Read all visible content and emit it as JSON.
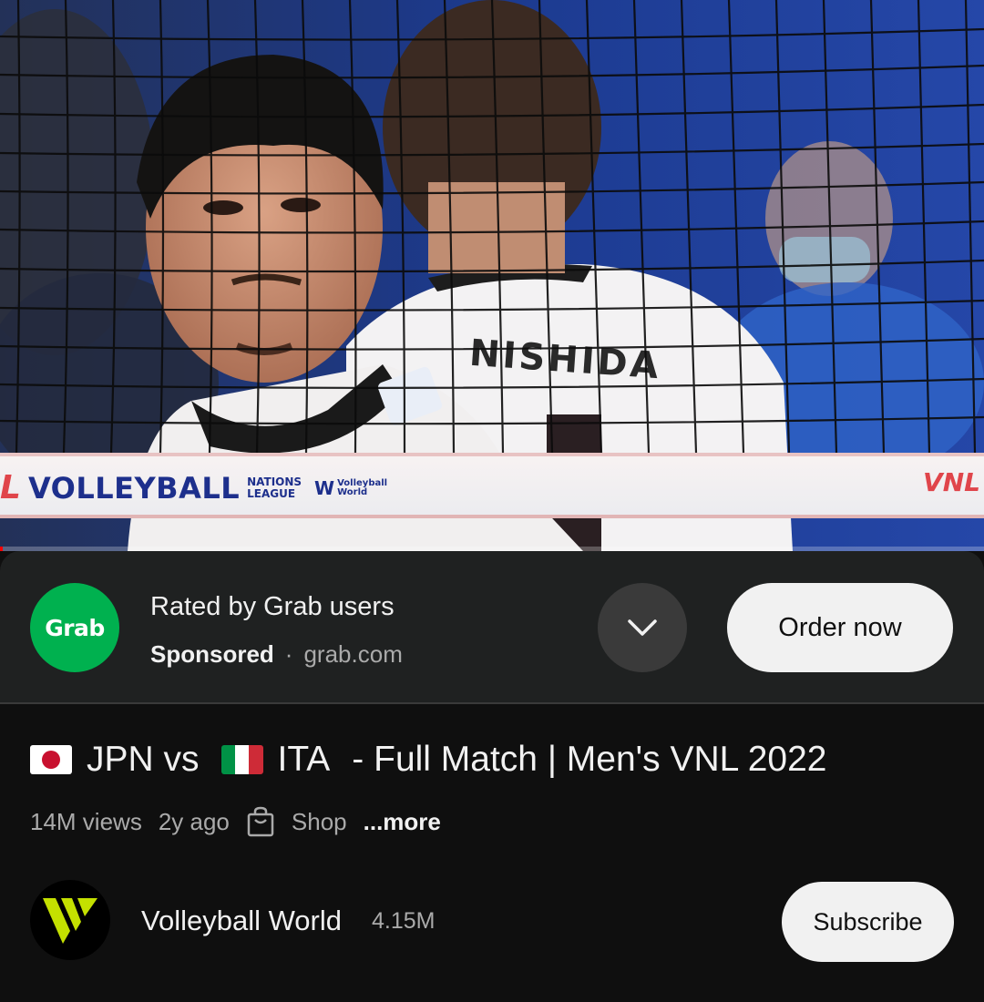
{
  "video": {
    "banner_left": "VOLLEYBALL",
    "banner_sub_1": "NATIONS",
    "banner_sub_2": "LEAGUE",
    "banner_vw_1": "Volleyball",
    "banner_vw_2": "World",
    "banner_right": "VNL",
    "jersey_name": "NISHIDA",
    "progress_fraction": 0.003
  },
  "ad": {
    "logo_text": "Grab",
    "title": "Rated by Grab users",
    "sponsored_label": "Sponsored",
    "separator": "·",
    "domain": "grab.com",
    "cta_label": "Order now",
    "expand_icon": "chevron-down-icon",
    "logo_color": "#00b14f"
  },
  "video_info": {
    "title_part_1": "JPN vs",
    "title_part_2": "ITA",
    "title_part_3": "- Full Match | Men's VNL 2022",
    "views": "14M views",
    "age": "2y ago",
    "shop_label": "Shop",
    "more_label": "...more"
  },
  "channel": {
    "name": "Volleyball World",
    "subscribers": "4.15M",
    "subscribe_label": "Subscribe",
    "avatar_color": "#c4e000"
  }
}
